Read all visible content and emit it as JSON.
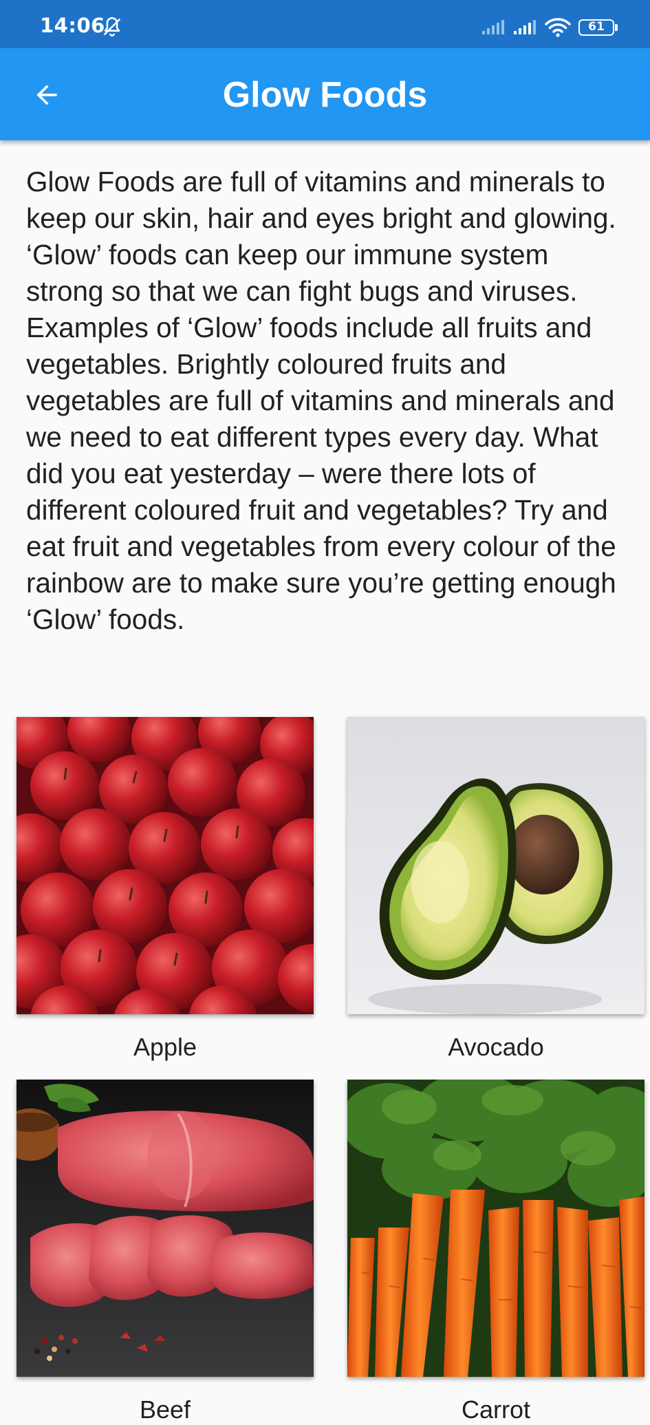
{
  "status_bar": {
    "time": "14:06",
    "battery": "61"
  },
  "app_bar": {
    "title": "Glow Foods"
  },
  "description": "Glow Foods are full of vitamins and minerals to keep our skin, hair and eyes bright and glowing. ‘Glow’ foods can keep our immune system strong so that we can fight bugs and viruses. Examples of ‘Glow’ foods include all fruits and vegetables. Brightly coloured fruits and vegetables are full of vitamins and minerals and we need to eat different types every day. What did you eat yesterday – were there lots of different coloured fruit and vegetables? Try and eat fruit and vegetables from every colour of the rainbow are to make sure you’re getting enough ‘Glow’ foods.",
  "foods": [
    {
      "label": "Apple"
    },
    {
      "label": "Avocado"
    },
    {
      "label": "Beef"
    },
    {
      "label": "Carrot"
    }
  ],
  "colors": {
    "status_bar": "#1e73c9",
    "app_bar": "#2196f3",
    "background": "#fafafa",
    "text": "#212121"
  }
}
